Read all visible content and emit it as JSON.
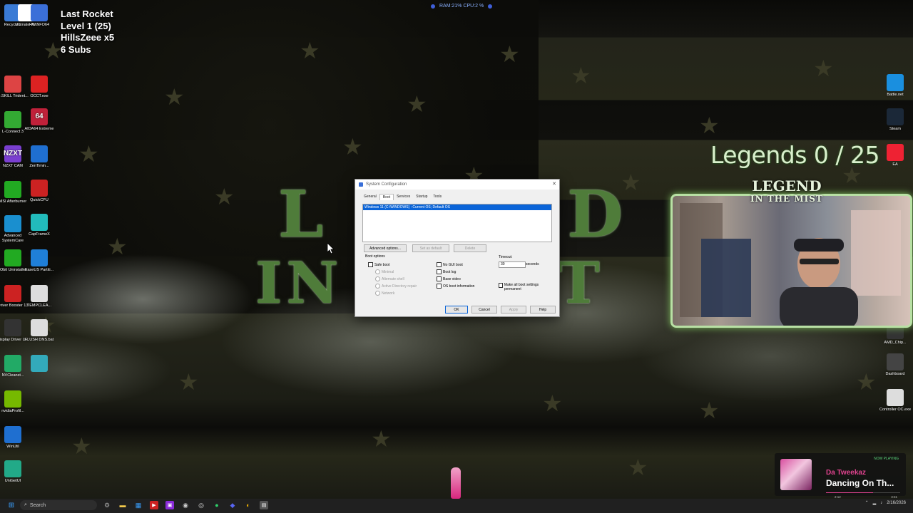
{
  "overlay": {
    "stream_stats": [
      "Last Rocket",
      "Level 1  (25)",
      "HillsZeee x5",
      "6 Subs"
    ],
    "perf": "RAM:21%  CPU:2 %",
    "legends_counter": "Legends  0 / 25",
    "webcam_label_top": "LEGEND",
    "webcam_label_bottom": "IN THE MIST"
  },
  "desktop_icons_left": [
    {
      "label": "Recycle...",
      "icon": "recycle-bin-icon",
      "color": "#3a7bd5"
    },
    {
      "label": "Ultimate-W...",
      "icon": "rocket-icon",
      "color": "#ffffff"
    },
    {
      "label": "HWiNFO64",
      "icon": "hwinfo-icon",
      "color": "#3b6fd8"
    },
    {
      "label": "G.SKILL Trident...",
      "icon": "gskill-icon",
      "color": "#d44"
    },
    {
      "label": "OCCT.exe",
      "icon": "occt-icon",
      "color": "#d22"
    },
    {
      "label": "L-Connect 3",
      "icon": "lconnect-icon",
      "color": "#3a3"
    },
    {
      "label": "AIDA64 Extreme",
      "icon": "aida64-icon",
      "color": "#c0213a",
      "glyph": "64"
    },
    {
      "label": "NZXT CAM",
      "icon": "nzxt-icon",
      "color": "#7a3fd0",
      "glyph": "NZXT"
    },
    {
      "label": "ZenTimin...",
      "icon": "zentimings-icon",
      "color": "#1f6fd0"
    },
    {
      "label": "MSI Afterburner",
      "icon": "msi-icon",
      "color": "#2a2"
    },
    {
      "label": "QuickCPU",
      "icon": "quickcpu-icon",
      "color": "#c22"
    },
    {
      "label": "Advanced SystemCare",
      "icon": "asc-icon",
      "color": "#1a8fcf"
    },
    {
      "label": "CapFrameX",
      "icon": "capframex-icon",
      "color": "#2bb"
    },
    {
      "label": "IObit Uninstaller",
      "icon": "iobit-icon",
      "color": "#2a2"
    },
    {
      "label": "EaseUS Partiti...",
      "icon": "easeus-icon",
      "color": "#1f7fd8"
    },
    {
      "label": "Driver Booster 13",
      "icon": "driverbooster-icon",
      "color": "#c22"
    },
    {
      "label": "TEMPCLEA...",
      "icon": "batch-file-icon",
      "color": "#ddd"
    },
    {
      "label": "Display Driver U...",
      "icon": "ddu-icon",
      "color": "#333"
    },
    {
      "label": "FLUSH DNS.bat",
      "icon": "batch-file-icon",
      "color": "#ddd"
    },
    {
      "label": "NVCleanst...",
      "icon": "nvcleanstall-icon",
      "color": "#2a6"
    },
    {
      "label": "",
      "icon": "app-icon",
      "color": "#3ab"
    },
    {
      "label": "nvidiaProfil...",
      "icon": "nvidia-icon",
      "color": "#76b900"
    },
    {
      "label": "WinUtil",
      "icon": "winutil-icon",
      "color": "#1f6fd0"
    },
    {
      "label": "UniGetUI",
      "icon": "unigetui-icon",
      "color": "#2a8"
    }
  ],
  "desktop_icons_right": [
    {
      "label": "Battle.net",
      "icon": "battlenet-icon",
      "color": "#1a8fdf"
    },
    {
      "label": "Steam",
      "icon": "steam-icon",
      "color": "#1b2838"
    },
    {
      "label": "EA",
      "icon": "ea-icon",
      "color": "#e23"
    },
    {
      "label": "AMD_Chip...",
      "icon": "amd-icon",
      "color": "#333"
    },
    {
      "label": "Dashboard",
      "icon": "dashboard-icon",
      "color": "#444"
    },
    {
      "label": "Controller OC.exe",
      "icon": "controller-icon",
      "color": "#ddd"
    }
  ],
  "dialog": {
    "title": "System Configuration",
    "tabs": [
      "General",
      "Boot",
      "Services",
      "Startup",
      "Tools"
    ],
    "active_tab": "Boot",
    "os_entry": "Windows 11 (C:\\WINDOWS) : Current OS; Default OS",
    "buttons": {
      "advanced": "Advanced options...",
      "set_default": "Set as default",
      "delete": "Delete",
      "ok": "OK",
      "cancel": "Cancel",
      "apply": "Apply",
      "help": "Help"
    },
    "boot_options_label": "Boot options",
    "safe_boot": "Safe boot",
    "minimal": "Minimal",
    "alternate_shell": "Alternate shell",
    "ad_repair": "Active Directory repair",
    "network": "Network",
    "no_gui_boot": "No GUI boot",
    "boot_log": "Boot log",
    "base_video": "Base video",
    "os_boot_info": "OS boot information",
    "timeout_label": "Timeout:",
    "timeout_value": "30",
    "seconds": "seconds",
    "make_permanent": "Make all boot settings permanent"
  },
  "now_playing": {
    "tag": "NOW PLAYING",
    "artist": "Da Tweekaz",
    "title": "Dancing On Th...",
    "elapsed": "2:12",
    "duration": "3:31",
    "progress": 0.63
  },
  "taskbar": {
    "search_placeholder": "Search",
    "date": "2/16/2026"
  }
}
